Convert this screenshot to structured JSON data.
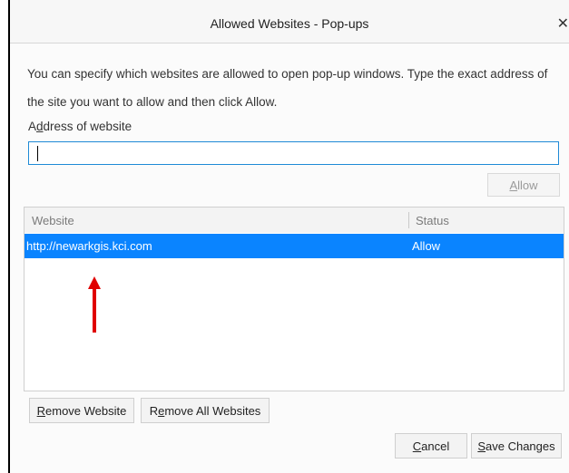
{
  "dialog": {
    "title": "Allowed Websites - Pop-ups",
    "close_icon": "close-icon",
    "description": "You can specify which websites are allowed to open pop-up windows. Type the exact address of the site you want to allow and then click Allow.",
    "address_label": "Address of website",
    "address_value": "",
    "allow_button": "Allow",
    "table": {
      "columns": [
        "Website",
        "Status"
      ],
      "rows": [
        {
          "website": "http://newarkgis.kci.com",
          "status": "Allow",
          "selected": true
        }
      ]
    },
    "buttons": {
      "remove_website": "Remove Website",
      "remove_all_websites": "Remove All Websites",
      "cancel": "Cancel",
      "save_changes": "Save Changes"
    },
    "colors": {
      "selection": "#0a84ff",
      "input_focus": "#1f8ad6",
      "annotation_arrow": "#e00000"
    },
    "annotation_icon": "red-up-arrow-icon"
  }
}
